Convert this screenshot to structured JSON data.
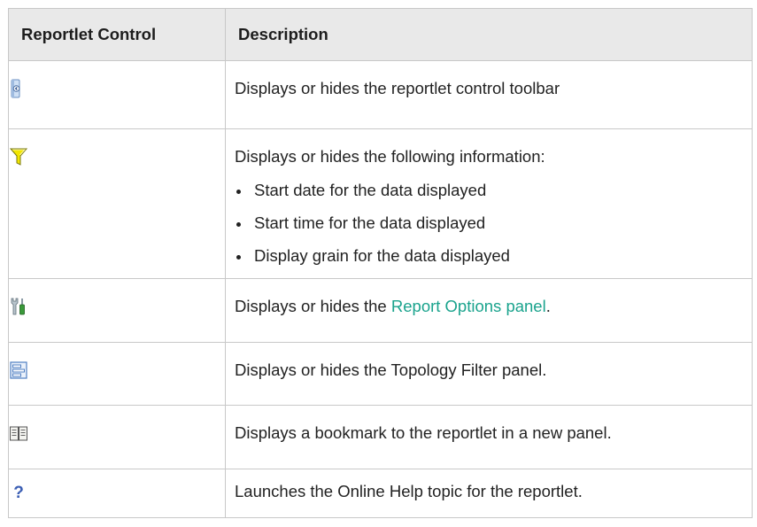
{
  "table": {
    "headers": [
      "Reportlet Control",
      "Description"
    ],
    "rows": [
      {
        "icon": "toolbar-toggle-icon",
        "text": "Displays or hides the reportlet control toolbar"
      },
      {
        "icon": "filter-funnel-icon",
        "text": "Displays or hides the following information:",
        "bullets": [
          "Start date for the data displayed",
          "Start time for the data displayed",
          "Display grain for the data displayed"
        ]
      },
      {
        "icon": "report-options-tools-icon",
        "text_before": "Displays or hides the ",
        "link": "Report Options panel",
        "text_after": "."
      },
      {
        "icon": "topology-filter-icon",
        "text": "Displays or hides the Topology Filter panel."
      },
      {
        "icon": "bookmark-book-icon",
        "text": "Displays a bookmark to the reportlet in a new panel."
      },
      {
        "icon": "help-question-icon",
        "text": "Launches the Online Help topic for the reportlet."
      }
    ]
  },
  "colors": {
    "link": "#1aa38d",
    "header_bg": "#e9e9e9",
    "border": "#c8c8c8"
  }
}
